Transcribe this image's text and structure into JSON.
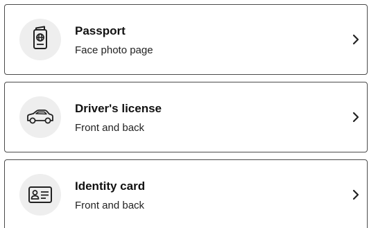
{
  "documents": [
    {
      "title": "Passport",
      "subtitle": "Face photo page",
      "icon": "passport-icon"
    },
    {
      "title": "Driver's license",
      "subtitle": "Front and back",
      "icon": "car-icon"
    },
    {
      "title": "Identity card",
      "subtitle": "Front and back",
      "icon": "id-card-icon"
    }
  ],
  "colors": {
    "border": "#4a4a4a",
    "icon_background": "#eeeeee",
    "text": "#111111"
  }
}
